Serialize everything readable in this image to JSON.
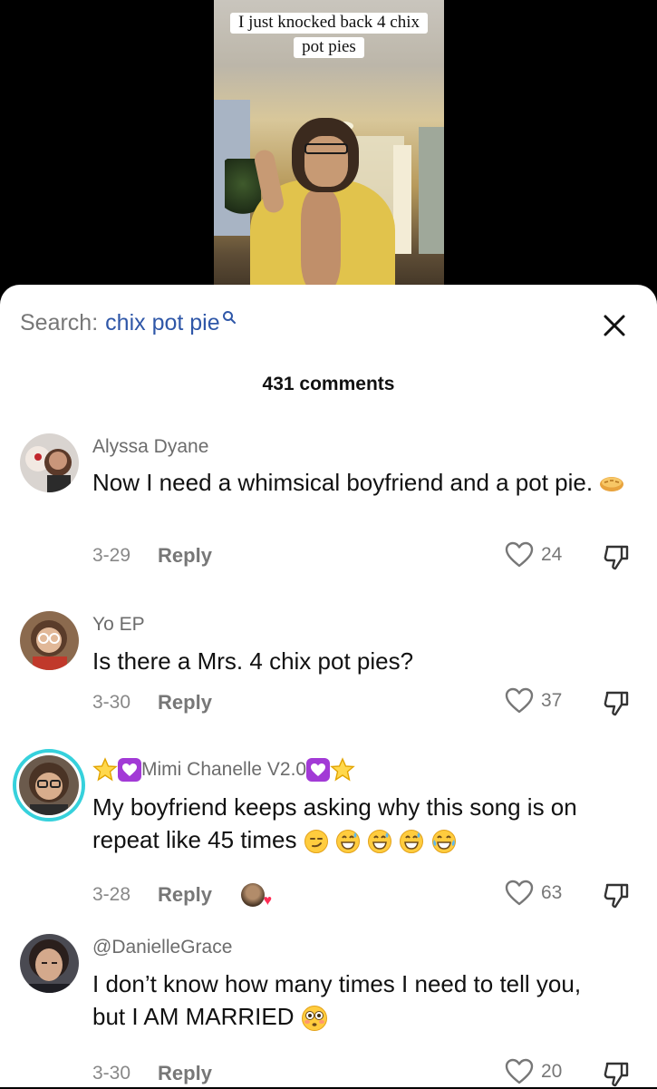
{
  "video": {
    "caption_line1": "I just knocked back 4 chix",
    "caption_line2": "pot pies"
  },
  "sheet": {
    "search_label": "Search:",
    "search_term": "chix pot pie",
    "comment_count": "431 comments"
  },
  "comments": [
    {
      "username": "Alyssa Dyane",
      "text": "Now I need a whimsical boyfriend and a pot pie.",
      "date": "3-29",
      "reply": "Reply",
      "likes": "24"
    },
    {
      "username": "Yo EP",
      "text": "Is there a Mrs. 4 chix pot pies?",
      "date": "3-30",
      "reply": "Reply",
      "likes": "37"
    },
    {
      "username": "Mimi Chanelle V2.0",
      "text_line1": "My boyfriend keeps asking why this song is on",
      "text_line2": "repeat like 45 times",
      "date": "3-28",
      "reply": "Reply",
      "likes": "63"
    },
    {
      "username": "@DanielleGrace",
      "text_line1": "I don’t know how many times I need to tell you,",
      "text_line2": "but I AM MARRIED",
      "date": "3-30",
      "reply": "Reply",
      "likes": "20"
    }
  ],
  "icons": {
    "search": "search-icon",
    "close": "close-icon",
    "like": "heart-outline-icon",
    "dislike": "thumbs-down-icon"
  },
  "colors": {
    "search_term": "#2f57a8",
    "avatar_ring": "#36d1dc",
    "badge": "#a23ad6"
  }
}
